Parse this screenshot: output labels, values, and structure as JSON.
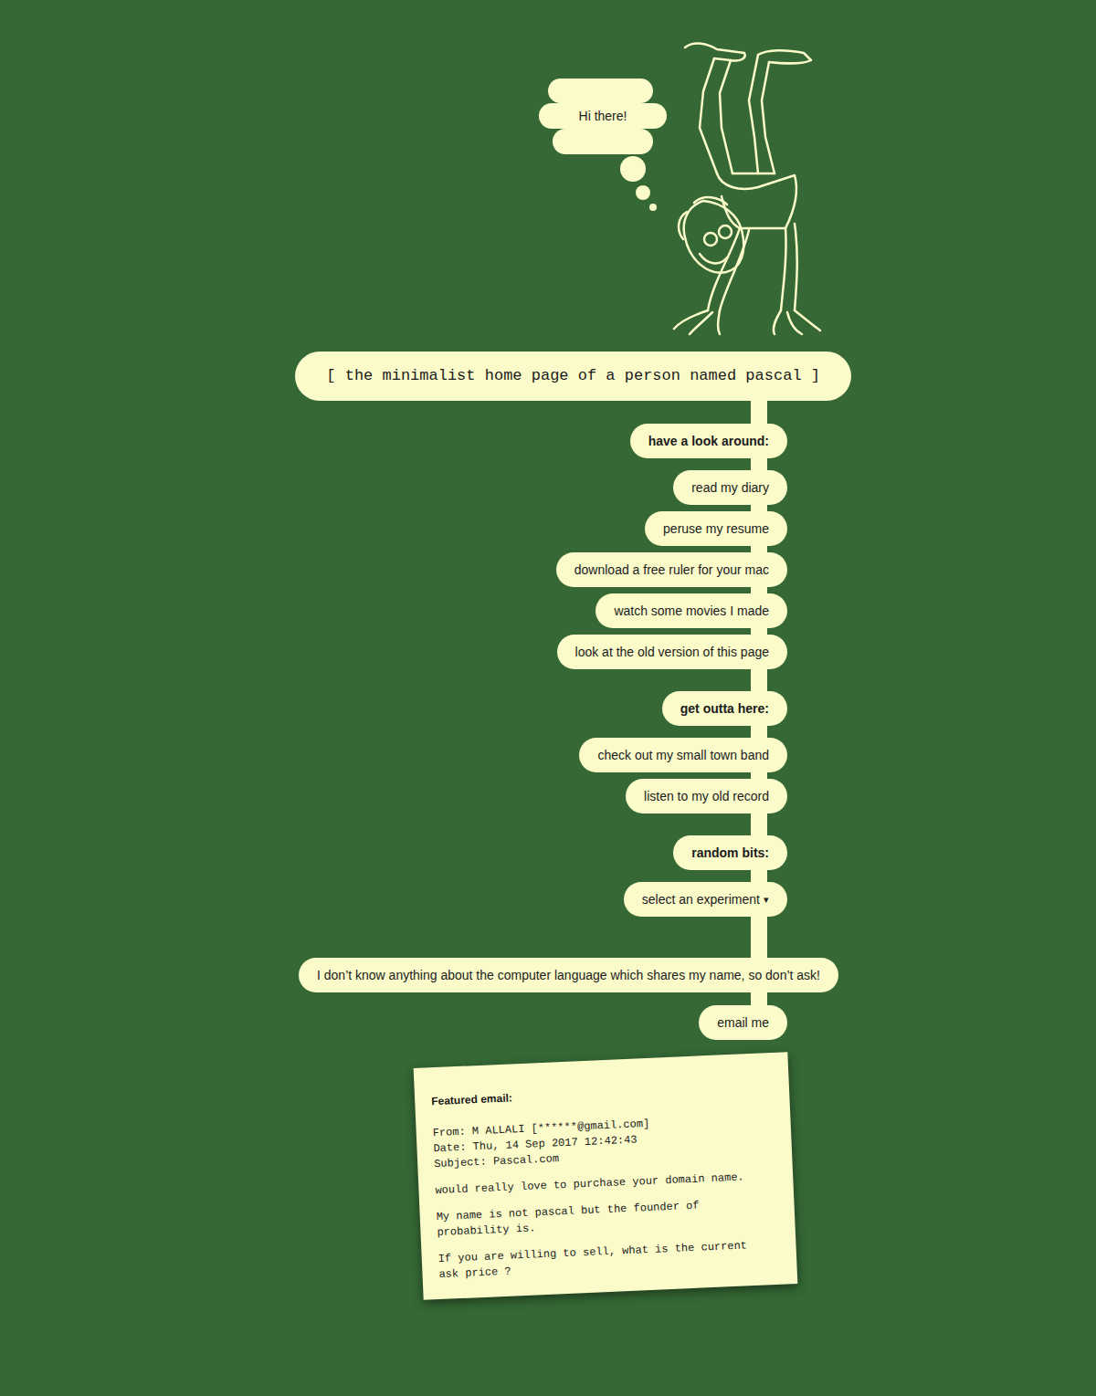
{
  "greeting": "Hi there!",
  "title": "[ the minimalist home page of a person named pascal ]",
  "sections": [
    {
      "heading": "have a look around:",
      "links": [
        "read my diary",
        "peruse my resume",
        "download a free ruler for your mac",
        "watch some movies I made",
        "look at the old version of this page"
      ]
    },
    {
      "heading": "get outta here:",
      "links": [
        "check out my small town band",
        "listen to my old record"
      ]
    },
    {
      "heading": "random bits:",
      "links": []
    }
  ],
  "dropdown": {
    "label": "select an experiment",
    "caret": "▾"
  },
  "note": "I don’t know anything about the computer language which shares my name, so don’t ask!",
  "email_link": "email me",
  "featured_email": {
    "heading": "Featured email:",
    "from": "From: M ALLALI [******@gmail.com]",
    "date": "Date: Thu, 14 Sep 2017 12:42:43",
    "subject": "Subject: Pascal.com",
    "paragraphs": [
      "would really love to purchase your domain name.",
      "My name is not pascal but the founder of probability is.",
      "If you are willing to sell, what is the current ask price ?"
    ]
  }
}
